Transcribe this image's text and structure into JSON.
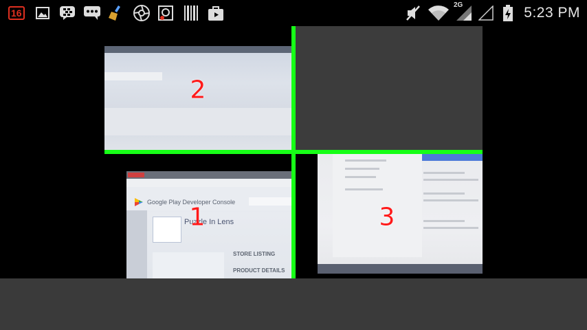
{
  "status_bar": {
    "notification_count": "16",
    "network_type": "2G",
    "time": "5:23 PM",
    "icons": [
      "notification-count-icon",
      "image-icon",
      "bbm-icon",
      "chat-icon",
      "broom-icon",
      "aperture-icon",
      "camera-app-icon",
      "barcode-icon",
      "shopping-bag-icon",
      "mute-icon",
      "wifi-icon",
      "signal-icon",
      "signal-empty-icon",
      "battery-charging-icon"
    ]
  },
  "camera_view": {
    "quadrants": [
      {
        "number": "1",
        "app_title": "Google Play Developer Console",
        "app_name": "Puzzle In Lens",
        "items": [
          "STORE LISTING",
          "PRODUCT DETAILS"
        ]
      },
      {
        "number": "2"
      },
      {
        "number": "3"
      }
    ],
    "grid_color": "#17ff17",
    "number_color": "#ff1a1a"
  }
}
